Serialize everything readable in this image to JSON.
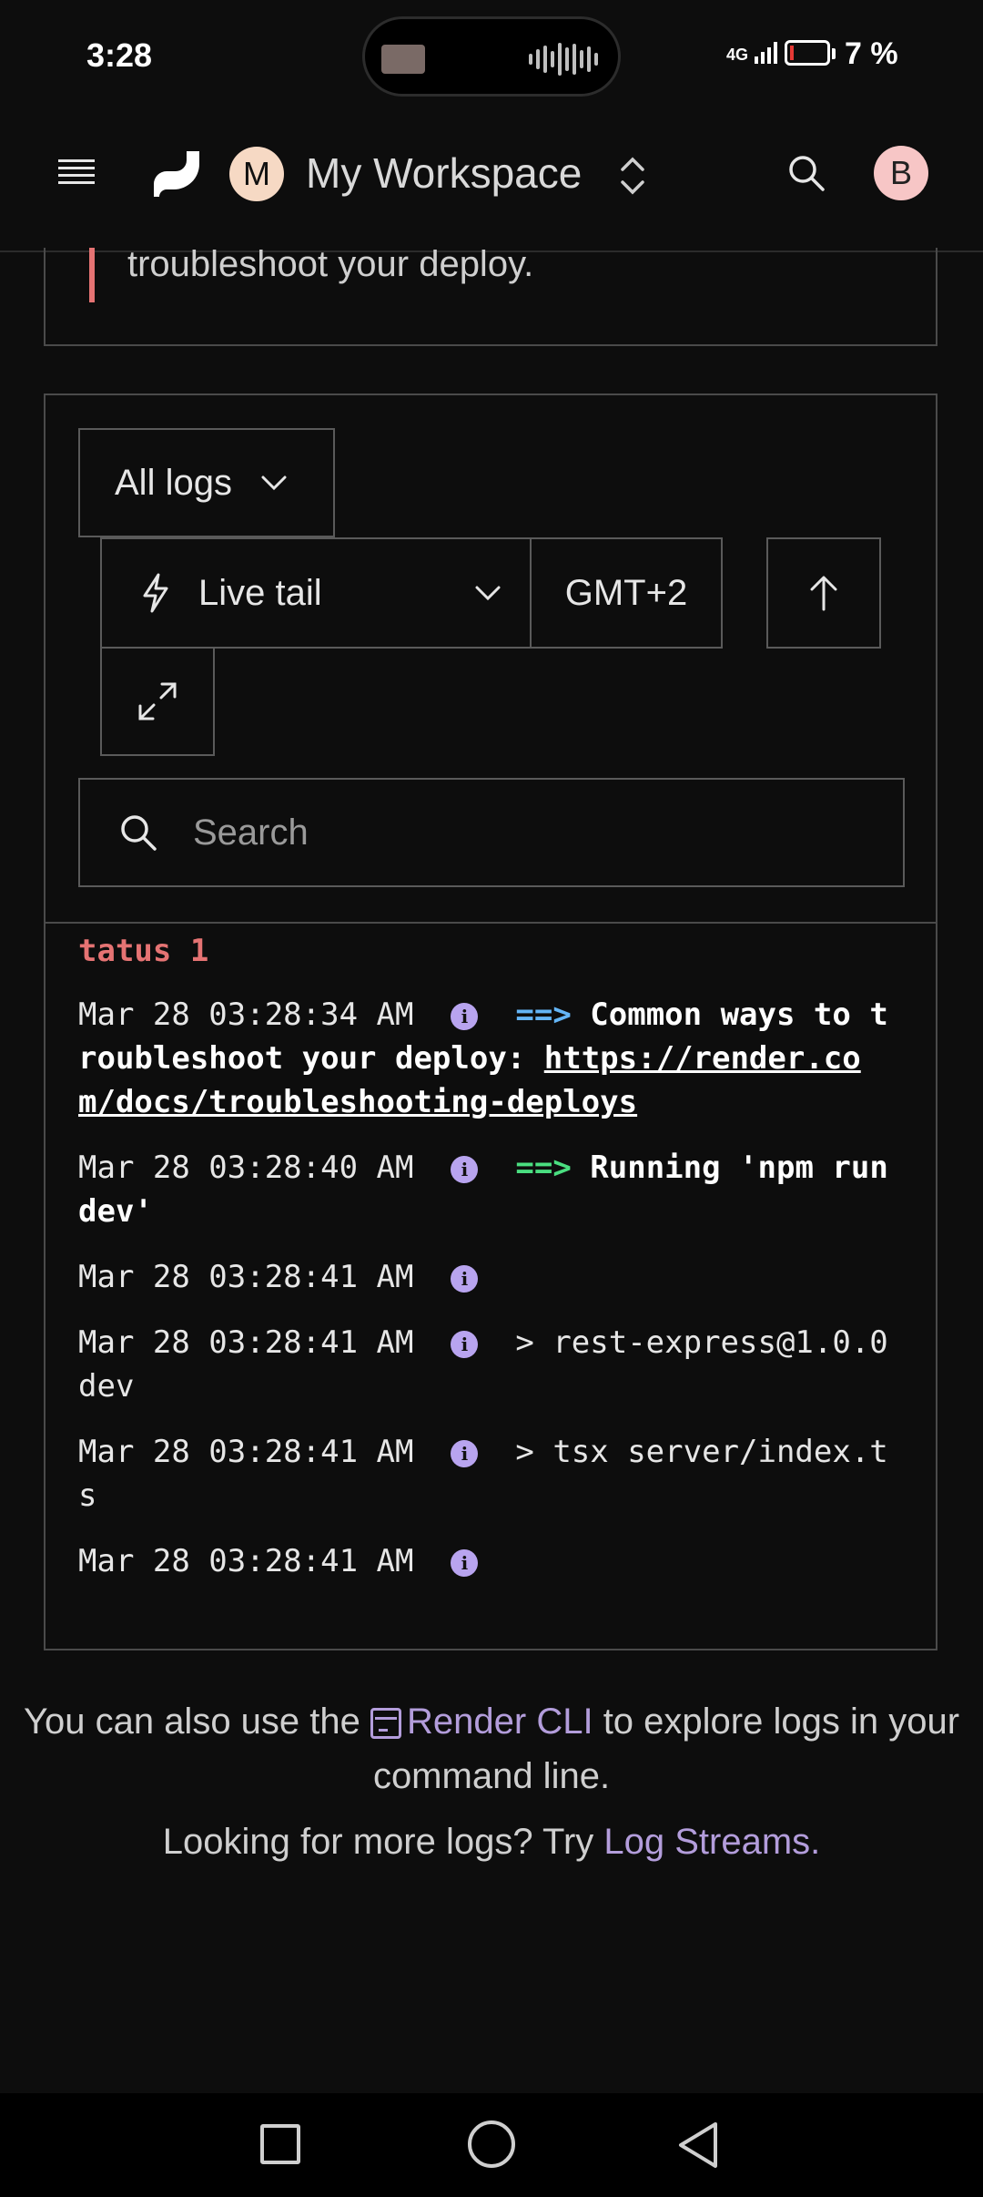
{
  "status_bar": {
    "time": "3:28",
    "network": "4G",
    "battery": "7 %"
  },
  "header": {
    "workspace_initial": "M",
    "workspace_name": "My Workspace",
    "user_initial": "B"
  },
  "callout": {
    "text": "troubleshoot your deploy."
  },
  "controls": {
    "log_filter": "All logs",
    "live_tail": "Live tail",
    "timezone": "GMT+2",
    "search_placeholder": "Search"
  },
  "logs": {
    "partial_line": "tatus 1",
    "lines": [
      {
        "ts": "Mar 28 03:28:34 AM",
        "arrow": "==>",
        "text": "Common ways to troubleshoot your deploy: ",
        "link": "https://render.com/docs/troubleshooting-deploys"
      },
      {
        "ts": "Mar 28 03:28:40 AM",
        "arrow": "==>",
        "text": "Running 'npm run dev'"
      },
      {
        "ts": "Mar 28 03:28:41 AM",
        "text": ""
      },
      {
        "ts": "Mar 28 03:28:41 AM",
        "text": "> rest-express@1.0.0 dev"
      },
      {
        "ts": "Mar 28 03:28:41 AM",
        "text": "> tsx server/index.ts"
      },
      {
        "ts": "Mar 28 03:28:41 AM",
        "text": ""
      }
    ]
  },
  "footer": {
    "cli_prefix": "You can also use the ",
    "cli_link": "Render CLI",
    "cli_suffix": " to explore logs in your command line.",
    "streams_prefix": "Looking for more logs? Try ",
    "streams_link": "Log Streams."
  },
  "colors": {
    "accent_purple": "#b39ddb",
    "arrow_blue": "#64b5f6",
    "arrow_green": "#4ade80",
    "error_red": "#e57373"
  }
}
